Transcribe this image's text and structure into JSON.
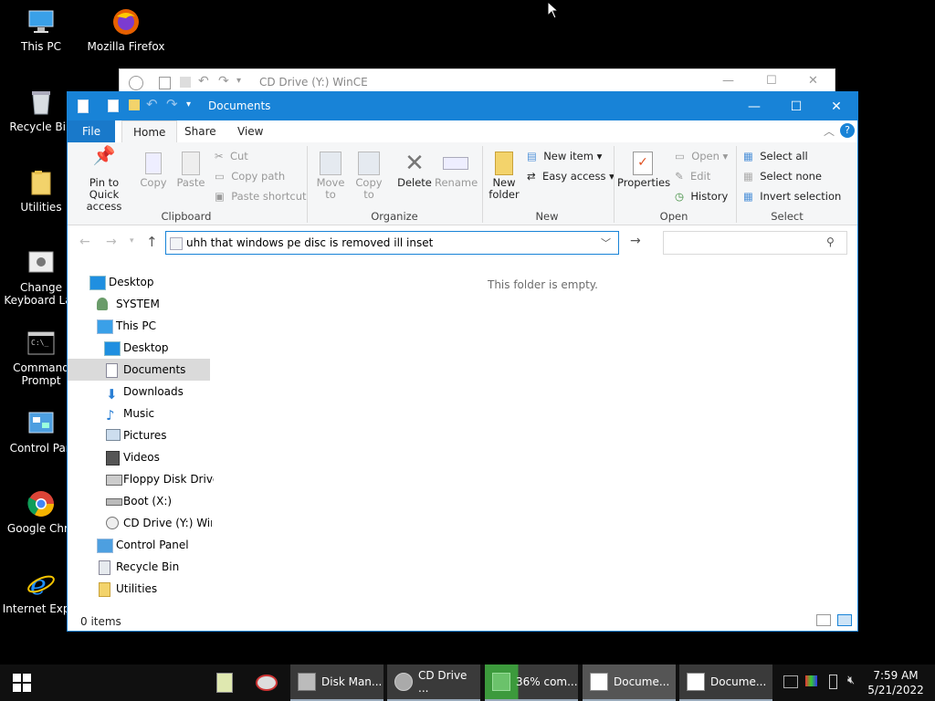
{
  "desktop": {
    "icons": [
      {
        "label": "This PC"
      },
      {
        "label": "Mozilla Firefox"
      },
      {
        "label": "Recycle Bin"
      },
      {
        "label": "Utilities"
      },
      {
        "label": "Change Keyboard Lay"
      },
      {
        "label": "Command Prompt"
      },
      {
        "label": "Control Pan"
      },
      {
        "label": "Google Chro"
      },
      {
        "label": "Internet Explo"
      }
    ]
  },
  "background_window": {
    "title": "CD Drive (Y:) WinCE"
  },
  "window": {
    "title": "Documents",
    "tabs": {
      "file": "File",
      "home": "Home",
      "share": "Share",
      "view": "View"
    },
    "ribbon": {
      "clipboard": {
        "pin": "Pin to Quick access",
        "copy": "Copy",
        "paste": "Paste",
        "cut": "Cut",
        "copy_path": "Copy path",
        "paste_shortcut": "Paste shortcut",
        "group": "Clipboard"
      },
      "organize": {
        "move_to": "Move to",
        "copy_to": "Copy to",
        "delete": "Delete",
        "rename": "Rename",
        "group": "Organize"
      },
      "new": {
        "new_folder": "New folder",
        "new_item": "New item",
        "easy_access": "Easy access",
        "group": "New"
      },
      "open": {
        "properties": "Properties",
        "open": "Open",
        "edit": "Edit",
        "history": "History",
        "group": "Open"
      },
      "select": {
        "select_all": "Select all",
        "select_none": "Select none",
        "invert": "Invert selection",
        "group": "Select"
      }
    },
    "address": {
      "value": "uhh that windows pe disc is removed ill inset"
    },
    "search": {
      "placeholder": ""
    },
    "nav": [
      {
        "label": "Desktop"
      },
      {
        "label": "SYSTEM"
      },
      {
        "label": "This PC"
      },
      {
        "label": "Desktop"
      },
      {
        "label": "Documents"
      },
      {
        "label": "Downloads"
      },
      {
        "label": "Music"
      },
      {
        "label": "Pictures"
      },
      {
        "label": "Videos"
      },
      {
        "label": "Floppy Disk Drive"
      },
      {
        "label": "Boot (X:)"
      },
      {
        "label": "CD Drive (Y:) WinC"
      },
      {
        "label": "Control Panel"
      },
      {
        "label": "Recycle Bin"
      },
      {
        "label": "Utilities"
      }
    ],
    "empty_message": "This folder is empty.",
    "status": "0 items"
  },
  "taskbar": {
    "tasks": [
      {
        "label": "Disk Man..."
      },
      {
        "label": "CD Drive ..."
      },
      {
        "label": "36% com..."
      },
      {
        "label": "Docume..."
      },
      {
        "label": "Docume..."
      }
    ],
    "time": "7:59 AM",
    "date": "5/21/2022"
  },
  "colors": {
    "accent": "#1883d7",
    "taskbar": "#101010",
    "ribbon": "#f5f6f7"
  }
}
